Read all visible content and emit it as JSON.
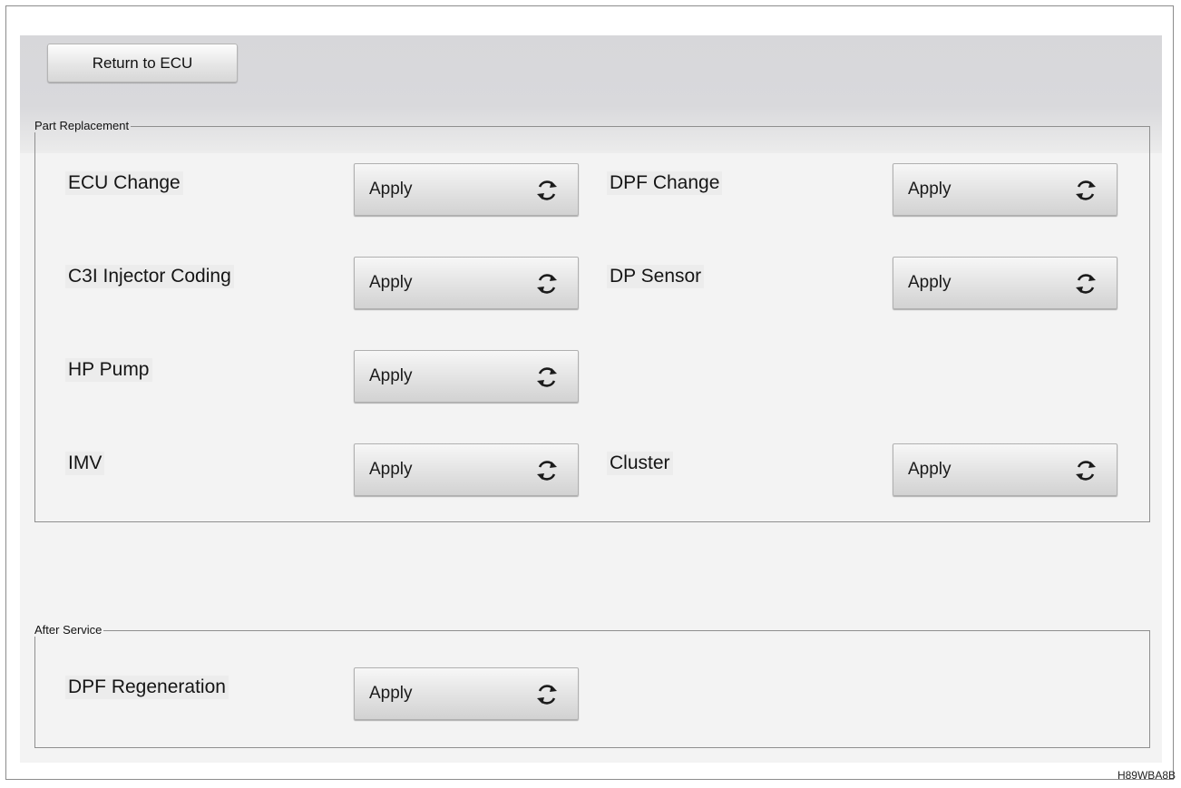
{
  "toolbar": {
    "return_label": "Return to ECU"
  },
  "part_replacement": {
    "title": "Part Replacement",
    "items": [
      {
        "label": "ECU Change",
        "button": "Apply"
      },
      {
        "label": "DPF Change",
        "button": "Apply"
      },
      {
        "label": "C3I Injector Coding",
        "button": "Apply"
      },
      {
        "label": "DP Sensor",
        "button": "Apply"
      },
      {
        "label": "HP Pump",
        "button": "Apply"
      },
      {
        "label": "IMV",
        "button": "Apply"
      },
      {
        "label": "Cluster",
        "button": "Apply"
      }
    ]
  },
  "after_service": {
    "title": "After Service",
    "items": [
      {
        "label": "DPF Regeneration",
        "button": "Apply"
      }
    ]
  },
  "footer": {
    "code": "H89WBA8B"
  },
  "icons": {
    "apply": "refresh-icon"
  },
  "colors": {
    "panel_bg": "#f3f3f3",
    "header_bg": "#d9d9dc"
  }
}
